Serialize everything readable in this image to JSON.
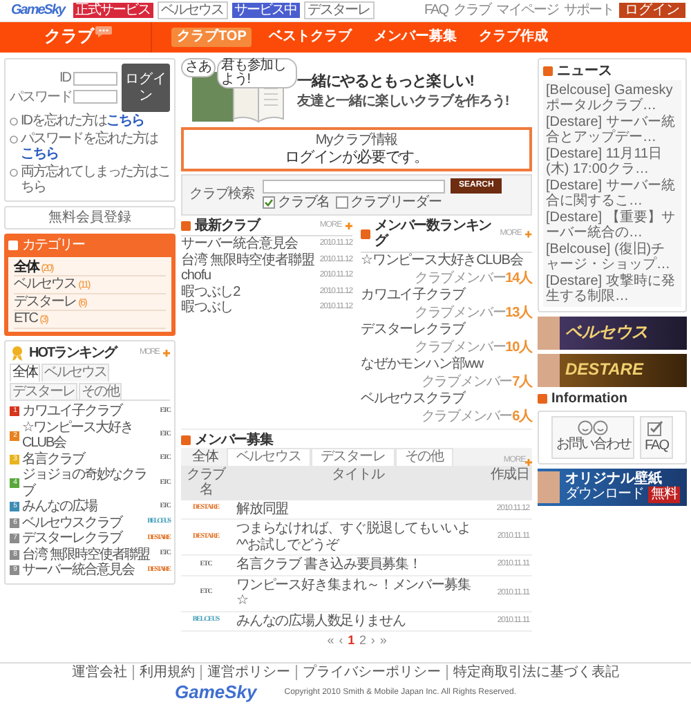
{
  "header": {
    "logo": "GameSky",
    "games": [
      {
        "badge": "正式サービス",
        "kind": "official",
        "name": "ベルセウス"
      },
      {
        "badge": "サービス中",
        "kind": "service",
        "name": "デスターレ"
      }
    ],
    "links": [
      "FAQ",
      "クラブ",
      "マイページ",
      "サポート"
    ],
    "login_button": "ログイン"
  },
  "club_bar": {
    "title": "クラブ",
    "nav": [
      {
        "label": "クラブTOP",
        "selected": true
      },
      {
        "label": "ベストクラブ",
        "selected": false
      },
      {
        "label": "メンバー募集",
        "selected": false
      },
      {
        "label": "クラブ作成",
        "selected": false
      }
    ]
  },
  "login": {
    "id_label": "ID",
    "password_label": "パスワード",
    "button": "ログイン",
    "help": [
      {
        "text": "IDを忘れた方は",
        "link": "こちら"
      },
      {
        "text": "パスワードを忘れた方は",
        "link": "こちら"
      },
      {
        "text": "両方忘れてしまった方はこちら"
      }
    ]
  },
  "register_button": "無料会員登録",
  "category": {
    "title": "カテゴリー",
    "items": [
      {
        "name": "全体",
        "count": "(20)",
        "selected": true
      },
      {
        "name": "ベルセウス",
        "count": "(11)",
        "selected": false
      },
      {
        "name": "デスターレ",
        "count": "(6)",
        "selected": false
      },
      {
        "name": "ETC",
        "count": "(3)",
        "selected": false
      }
    ]
  },
  "hot_ranking": {
    "title": "HOTランキング",
    "more": "MORE",
    "tabs": [
      {
        "label": "全体",
        "selected": true
      },
      {
        "label": "ベルセウス",
        "selected": false
      },
      {
        "label": "デスターレ",
        "selected": false
      },
      {
        "label": "その他",
        "selected": false
      }
    ],
    "items": [
      {
        "rank": "1",
        "color": "#d8351c",
        "name": "カワユイ子クラブ",
        "tag": "ETC",
        "kind": "etc"
      },
      {
        "rank": "2",
        "color": "#e8821e",
        "name": "☆ワンピース大好きCLUB会",
        "tag": "ETC",
        "kind": "etc"
      },
      {
        "rank": "3",
        "color": "#e8b41e",
        "name": "名言クラブ",
        "tag": "ETC",
        "kind": "etc"
      },
      {
        "rank": "4",
        "color": "#5aa83c",
        "name": "ジョジョの奇妙なクラブ",
        "tag": "ETC",
        "kind": "etc"
      },
      {
        "rank": "5",
        "color": "#3c8cb4",
        "name": "みんなの広場",
        "tag": "ETC",
        "kind": "etc"
      },
      {
        "rank": "6",
        "color": "#8c8c8c",
        "name": "ベルセウスクラブ",
        "tag": "BELCEUS",
        "kind": "belceus"
      },
      {
        "rank": "7",
        "color": "#8c8c8c",
        "name": "デスターレクラブ",
        "tag": "DESTARE",
        "kind": "destare"
      },
      {
        "rank": "8",
        "color": "#8c8c8c",
        "name": "台湾 無限時空使者聯盟",
        "tag": "ETC",
        "kind": "etc"
      },
      {
        "rank": "9",
        "color": "#8c8c8c",
        "name": "サーバー統合意見会",
        "tag": "DESTARE",
        "kind": "destare"
      }
    ]
  },
  "hero": {
    "bubbles": [
      "さあ",
      "君も参加しよう!"
    ],
    "headline": "一緒にやるともっと楽しい!",
    "subline": "友達と一緒に楽しいクラブを作ろう!"
  },
  "my_club": {
    "title": "Myクラブ情報",
    "message": "ログインが必要です。"
  },
  "search": {
    "label": "クラブ検索",
    "button": "SEARCH",
    "options": [
      {
        "label": "クラブ名",
        "checked": true
      },
      {
        "label": "クラブリーダー",
        "checked": false
      }
    ]
  },
  "latest_clubs": {
    "title": "最新クラブ",
    "more": "MORE",
    "items": [
      {
        "name": "サーバー統合意見会",
        "date": "2010.11.12"
      },
      {
        "name": "台湾 無限時空使者聯盟",
        "date": "2010.11.12"
      },
      {
        "name": "chofu",
        "date": "2010.11.12"
      },
      {
        "name": "暇つぶし2",
        "date": "2010.11.12"
      },
      {
        "name": "暇つぶし",
        "date": "2010.11.12"
      }
    ]
  },
  "member_ranking": {
    "title": "メンバー数ランキング",
    "more": "MORE",
    "items": [
      {
        "name": "☆ワンピース大好きCLUB会",
        "label": "クラブメンバー",
        "count": "14人"
      },
      {
        "name": "カワユイ子クラブ",
        "label": "クラブメンバー",
        "count": "13人"
      },
      {
        "name": "デスターレクラブ",
        "label": "クラブメンバー",
        "count": "10人"
      },
      {
        "name": "なぜかモンハン部ww",
        "label": "クラブメンバー",
        "count": "7人"
      },
      {
        "name": "ベルセウスクラブ",
        "label": "クラブメンバー",
        "count": "6人"
      }
    ]
  },
  "recruit": {
    "title": "メンバー募集",
    "more": "MORE",
    "tabs": [
      {
        "label": "全体",
        "selected": true
      },
      {
        "label": "ベルセウス",
        "selected": false
      },
      {
        "label": "デスターレ",
        "selected": false
      },
      {
        "label": "その他",
        "selected": false
      }
    ],
    "columns": [
      "クラブ名",
      "タイトル",
      "作成日"
    ],
    "rows": [
      {
        "tag": "DESTARE",
        "kind": "destare",
        "title": "解放同盟",
        "date": "2010.11.12"
      },
      {
        "tag": "DESTARE",
        "kind": "destare",
        "title": "つまらなければ、すぐ脱退してもいいよ^^お試しでどうぞ",
        "date": "2010.11.11"
      },
      {
        "tag": "ETC",
        "kind": "etc",
        "title": "名言クラブ 書き込み要員募集！",
        "date": "2010.11.11"
      },
      {
        "tag": "ETC",
        "kind": "etc",
        "title": "ワンピース好き集まれ～！メンバー募集☆",
        "date": "2010.11.11"
      },
      {
        "tag": "BELCEUS",
        "kind": "belceus",
        "title": "みんなの広場人数足りません",
        "date": "2010.11.11"
      }
    ],
    "pager": [
      {
        "label": "«",
        "selected": false
      },
      {
        "label": "‹",
        "selected": false
      },
      {
        "label": "1",
        "selected": true
      },
      {
        "label": "2",
        "selected": false
      },
      {
        "label": "›",
        "selected": false
      },
      {
        "label": "»",
        "selected": false
      }
    ]
  },
  "news": {
    "title": "ニュース",
    "items": [
      "[Belcouse] Gameskyポータルクラブ…",
      "[Destare] サーバー統合とアップデー…",
      "[Destare] 11月11日(木) 17:00クラ…",
      "[Destare] サーバー統合に関するこ…",
      "[Destare] 【重要】サーバー統合の…",
      "[Belcouse] (復旧)チャージ・ショップ…",
      "[Destare] 攻撃時に発生する制限…"
    ]
  },
  "game_banners": [
    {
      "kind": "belceus",
      "text": "ベルセウス"
    },
    {
      "kind": "destare",
      "text": "DESTARE"
    }
  ],
  "information": {
    "title": "Information",
    "items": [
      {
        "kind": "contact",
        "label": "お問い合わせ"
      },
      {
        "kind": "faq",
        "label": "FAQ"
      }
    ]
  },
  "wallpaper_banner": {
    "title": "オリジナル壁紙",
    "subtitle": "ダウンロード",
    "badge": "無料"
  },
  "footer": {
    "links": [
      "運営会社",
      "利用規約",
      "運営ポリシー",
      "プライバシーポリシー",
      "特定商取引法に基づく表記"
    ],
    "logo": "GameSky",
    "copyright": "Copyright 2010 Smith & Mobile Japan Inc. All Rights Reserved."
  }
}
